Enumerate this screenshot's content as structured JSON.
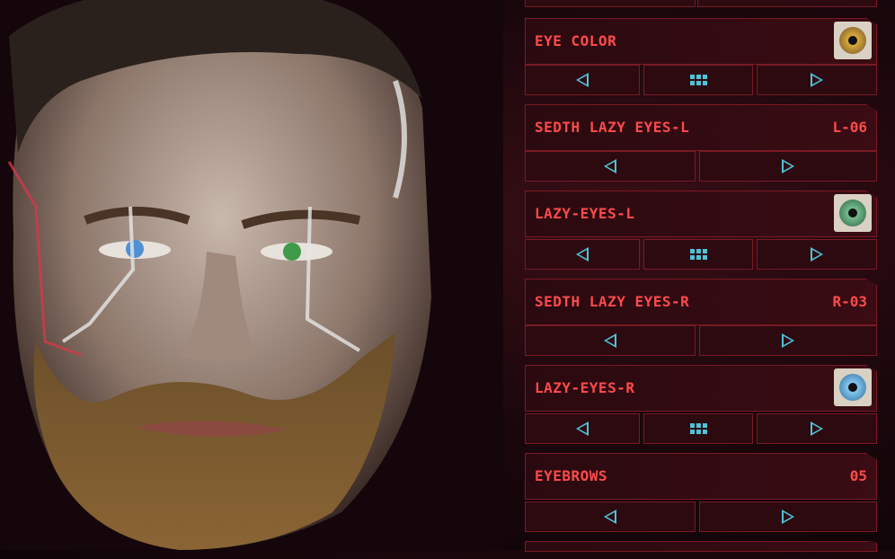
{
  "panel": {
    "rows": [
      {
        "label": "EYE COLOR",
        "swatch_color": "#8a6a2a"
      },
      {
        "label": "SEDTH LAZY EYES-L",
        "value": "L-06"
      },
      {
        "label": "LAZY-EYES-L",
        "swatch_color": "#3f7a54"
      },
      {
        "label": "SEDTH LAZY EYES-R",
        "value": "R-03"
      },
      {
        "label": "LAZY-EYES-R",
        "swatch_color": "#3a84b4"
      },
      {
        "label": "EYEBROWS",
        "value": "05"
      }
    ]
  },
  "colors": {
    "accent_red": "#ff4a4a",
    "accent_cyan": "#4fc3d8",
    "panel_border": "#7a1a24"
  }
}
